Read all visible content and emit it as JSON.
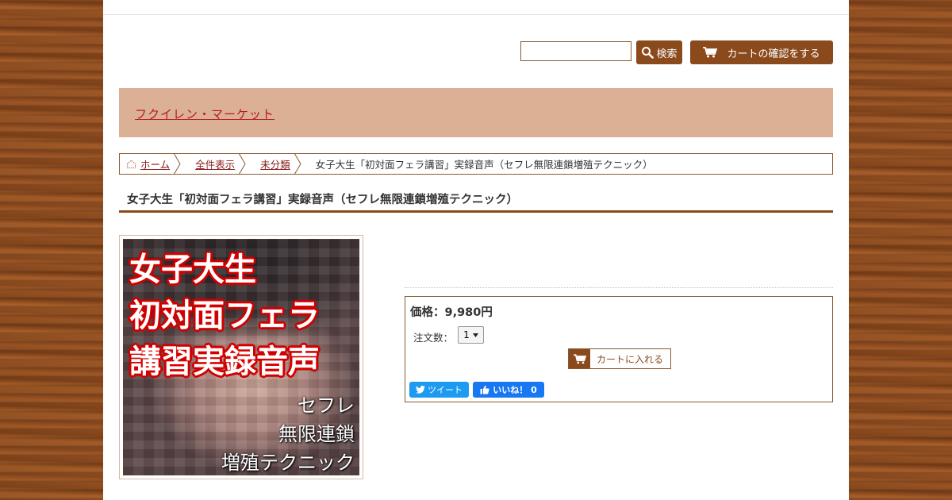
{
  "header": {
    "search_placeholder": "",
    "search_button_label": "検索",
    "cart_button_label": "カートの確認をする"
  },
  "banner": {
    "shop_name": "フクイレン・マーケット"
  },
  "breadcrumb": {
    "items": [
      "ホーム",
      "全件表示",
      "未分類"
    ],
    "current": "女子大生「初対面フェラ講習」実録音声（セフレ無限連鎖増殖テクニック）"
  },
  "product": {
    "title": "女子大生「初対面フェラ講習」実録音声（セフレ無限連鎖増殖テクニック）",
    "price": "価格：9,980円",
    "qty_label": "注文数：",
    "qty_value": "1",
    "add_to_cart_label": "カートに入れる",
    "tweet_label": "ツイート",
    "like_label": "いいね！ 0"
  },
  "product_image": {
    "headline_lines": [
      "女子大生",
      "初対面フェラ",
      "講習実録音声"
    ],
    "sub_lines": [
      "セフレ",
      "無限連鎖",
      "増殖テクニック"
    ]
  },
  "colors": {
    "accent_brown": "#8b4a1c",
    "banner_bg": "#dcb095",
    "link_red": "#8b1a1a",
    "shop_name_red": "#b21e1e"
  }
}
